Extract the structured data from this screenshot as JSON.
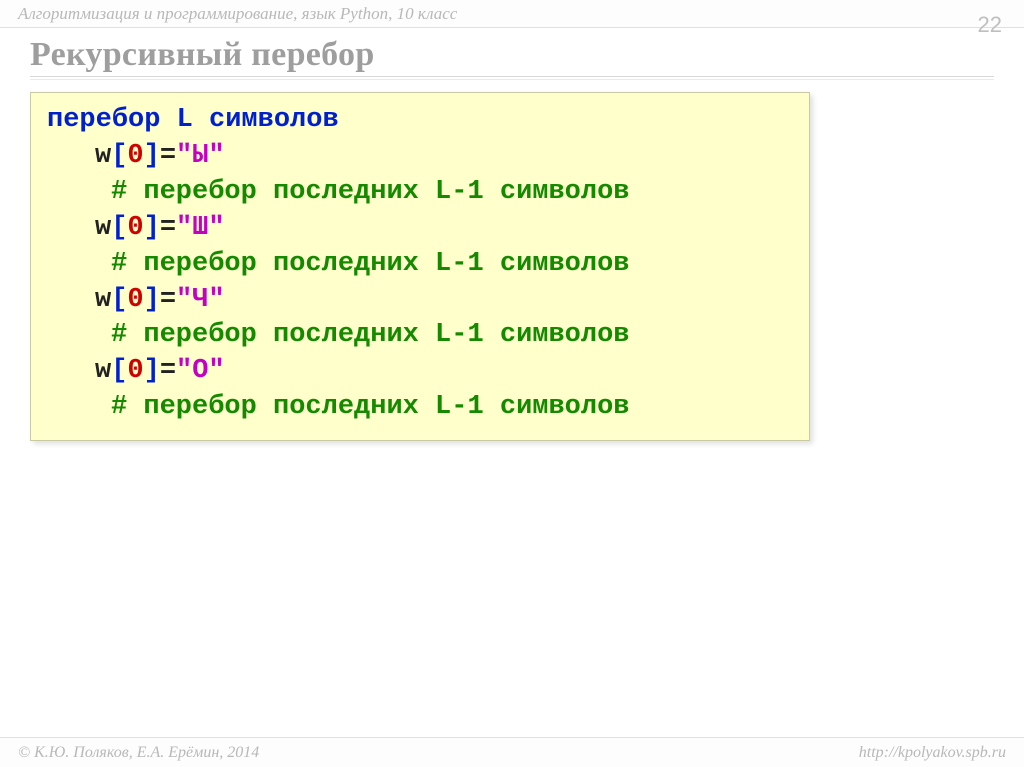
{
  "header": {
    "breadcrumb": "Алгоритмизация и программирование, язык Python, 10 класс",
    "page_num": "22"
  },
  "title": "Рекурсивный перебор",
  "code": {
    "first_line": "перебор L символов",
    "var": "w",
    "open": "[",
    "close": "]",
    "idx": "0",
    "eq": "=",
    "vals": [
      "\"Ы\"",
      "\"Ш\"",
      "\"Ч\"",
      "\"О\""
    ],
    "comment": "# перебор последних L-1 символов"
  },
  "footer": {
    "left": "© К.Ю. Поляков, Е.А. Ерёмин, 2014",
    "right": "http://kpolyakov.spb.ru"
  }
}
